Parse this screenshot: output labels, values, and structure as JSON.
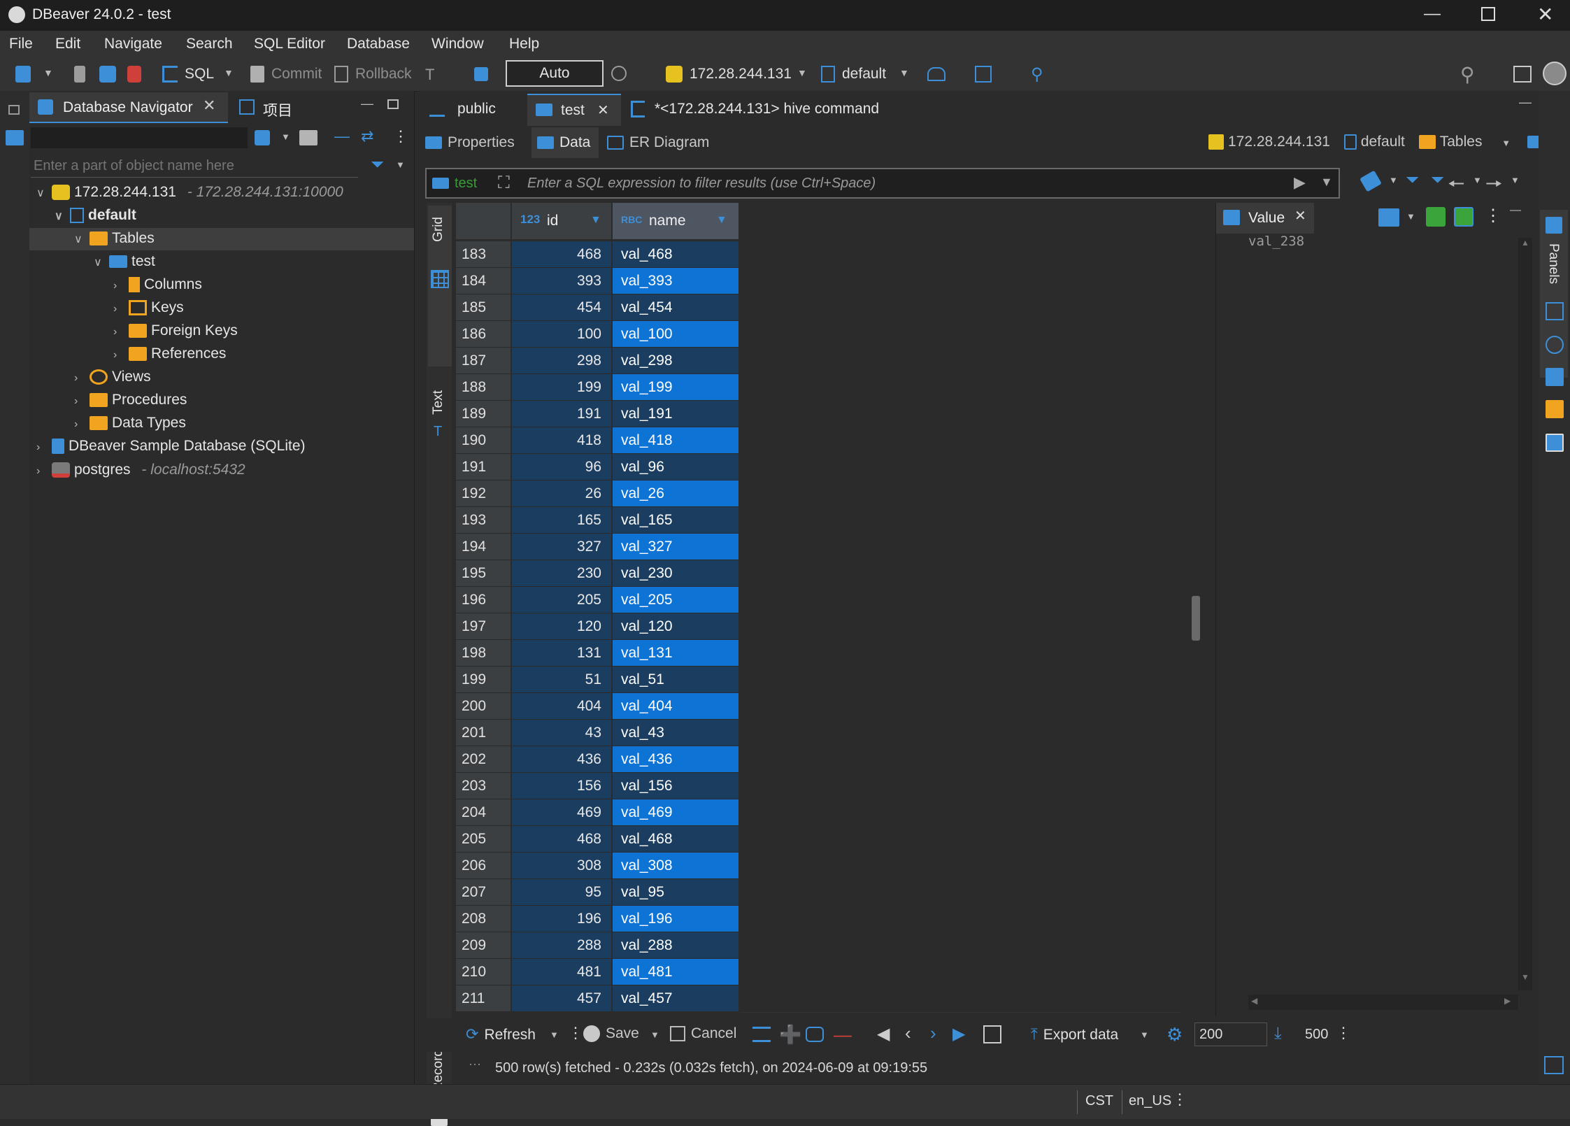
{
  "window": {
    "title": "DBeaver 24.0.2 - test",
    "controls": [
      "minimize-icon",
      "maximize-icon",
      "close-icon"
    ]
  },
  "menu": [
    "File",
    "Edit",
    "Navigate",
    "Search",
    "SQL Editor",
    "Database",
    "Window",
    "Help"
  ],
  "toolbar": {
    "sql_label": "SQL",
    "commit_label": "Commit",
    "rollback_label": "Rollback",
    "transaction_mode": "Auto",
    "connection": "172.28.244.131",
    "schema": "default"
  },
  "navigator": {
    "tab_label": "Database Navigator",
    "tab2_label": "项目",
    "search_placeholder": "Enter a part of object name here",
    "tree": {
      "connection": "172.28.244.131",
      "connection_hint": "- 172.28.244.131:10000",
      "default": "default",
      "tables": "Tables",
      "test": "test",
      "columns": "Columns",
      "keys": "Keys",
      "foreign_keys": "Foreign Keys",
      "references": "References",
      "views": "Views",
      "procedures": "Procedures",
      "data_types": "Data Types",
      "sample_db": "DBeaver Sample Database (SQLite)",
      "postgres": "postgres",
      "postgres_hint": "- localhost:5432"
    }
  },
  "editor_tabs": {
    "public": "public",
    "test": "test",
    "hive": "*<172.28.244.131> hive command"
  },
  "subtabs": {
    "properties": "Properties",
    "data": "Data",
    "er": "ER Diagram"
  },
  "breadcrumb": {
    "connection": "172.28.244.131",
    "schema": "default",
    "tables": "Tables",
    "table": "test"
  },
  "filter": {
    "table_label": "test",
    "placeholder": "Enter a SQL expression to filter results (use Ctrl+Space)"
  },
  "side_labels": {
    "grid": "Grid",
    "text": "Text",
    "record": "Record"
  },
  "grid": {
    "columns": [
      {
        "type": "123",
        "name": "id"
      },
      {
        "type": "RBC",
        "name": "name"
      }
    ],
    "rows": [
      {
        "num": "183",
        "id": "468",
        "name": "val_468"
      },
      {
        "num": "184",
        "id": "393",
        "name": "val_393"
      },
      {
        "num": "185",
        "id": "454",
        "name": "val_454"
      },
      {
        "num": "186",
        "id": "100",
        "name": "val_100"
      },
      {
        "num": "187",
        "id": "298",
        "name": "val_298"
      },
      {
        "num": "188",
        "id": "199",
        "name": "val_199"
      },
      {
        "num": "189",
        "id": "191",
        "name": "val_191"
      },
      {
        "num": "190",
        "id": "418",
        "name": "val_418"
      },
      {
        "num": "191",
        "id": "96",
        "name": "val_96"
      },
      {
        "num": "192",
        "id": "26",
        "name": "val_26"
      },
      {
        "num": "193",
        "id": "165",
        "name": "val_165"
      },
      {
        "num": "194",
        "id": "327",
        "name": "val_327"
      },
      {
        "num": "195",
        "id": "230",
        "name": "val_230"
      },
      {
        "num": "196",
        "id": "205",
        "name": "val_205"
      },
      {
        "num": "197",
        "id": "120",
        "name": "val_120"
      },
      {
        "num": "198",
        "id": "131",
        "name": "val_131"
      },
      {
        "num": "199",
        "id": "51",
        "name": "val_51"
      },
      {
        "num": "200",
        "id": "404",
        "name": "val_404"
      },
      {
        "num": "201",
        "id": "43",
        "name": "val_43"
      },
      {
        "num": "202",
        "id": "436",
        "name": "val_436"
      },
      {
        "num": "203",
        "id": "156",
        "name": "val_156"
      },
      {
        "num": "204",
        "id": "469",
        "name": "val_469"
      },
      {
        "num": "205",
        "id": "468",
        "name": "val_468"
      },
      {
        "num": "206",
        "id": "308",
        "name": "val_308"
      },
      {
        "num": "207",
        "id": "95",
        "name": "val_95"
      },
      {
        "num": "208",
        "id": "196",
        "name": "val_196"
      },
      {
        "num": "209",
        "id": "288",
        "name": "val_288"
      },
      {
        "num": "210",
        "id": "481",
        "name": "val_481"
      },
      {
        "num": "211",
        "id": "457",
        "name": "val_457"
      }
    ]
  },
  "value_panel": {
    "title": "Value",
    "content": "val_238",
    "side_label": "Panels"
  },
  "bottom_toolbar": {
    "refresh": "Refresh",
    "save": "Save",
    "cancel": "Cancel",
    "export": "Export data",
    "fetch_size": "200",
    "fetch_all": "500"
  },
  "status": {
    "message": "500 row(s) fetched - 0.232s (0.032s fetch), on 2024-06-09 at 09:19:55",
    "timezone": "CST",
    "locale": "en_US"
  },
  "colors": {
    "accent": "#0d74d6",
    "selection_dark": "#1a3d60",
    "folder": "#f0a41f"
  }
}
